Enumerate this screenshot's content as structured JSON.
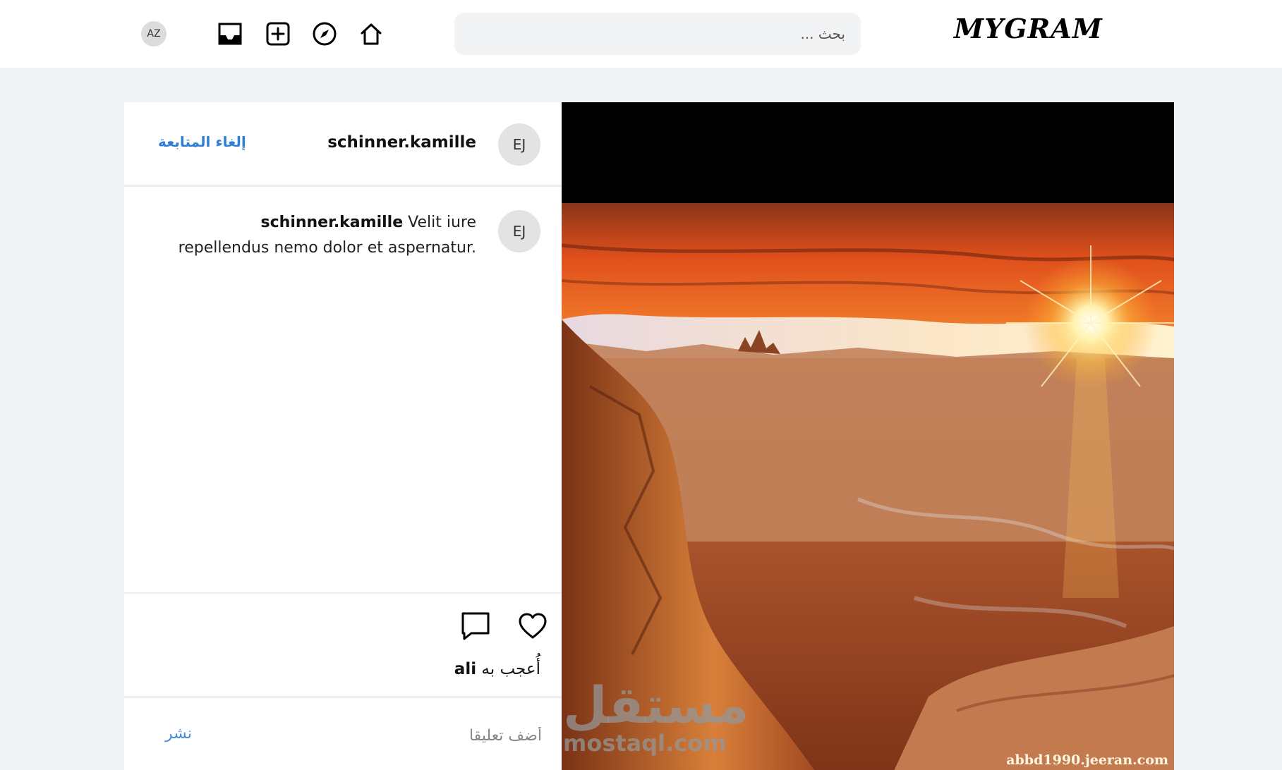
{
  "header": {
    "logo": "MYGRAM",
    "search_placeholder": "بحث ...",
    "user_initials": "AZ",
    "nav_icons": [
      "home-icon",
      "explore-icon",
      "add-post-icon",
      "inbox-icon"
    ]
  },
  "post": {
    "author": {
      "initials": "EJ",
      "username": "schinner.kamille"
    },
    "unfollow_label": "إلغاء المتابعة",
    "caption": {
      "initials": "EJ",
      "username": "schinner.kamille",
      "text": "Velit iure repellendus nemo dolor et aspernatur."
    },
    "likes": {
      "prefix": "أُعجب به",
      "liker": "ali"
    },
    "comment_placeholder": "أضف تعليقا",
    "post_label": "نشر",
    "image": {
      "watermark": "abbd1990.jeeran.com",
      "brand_ar": "مستقل",
      "brand_en": "mostaql.com"
    }
  }
}
